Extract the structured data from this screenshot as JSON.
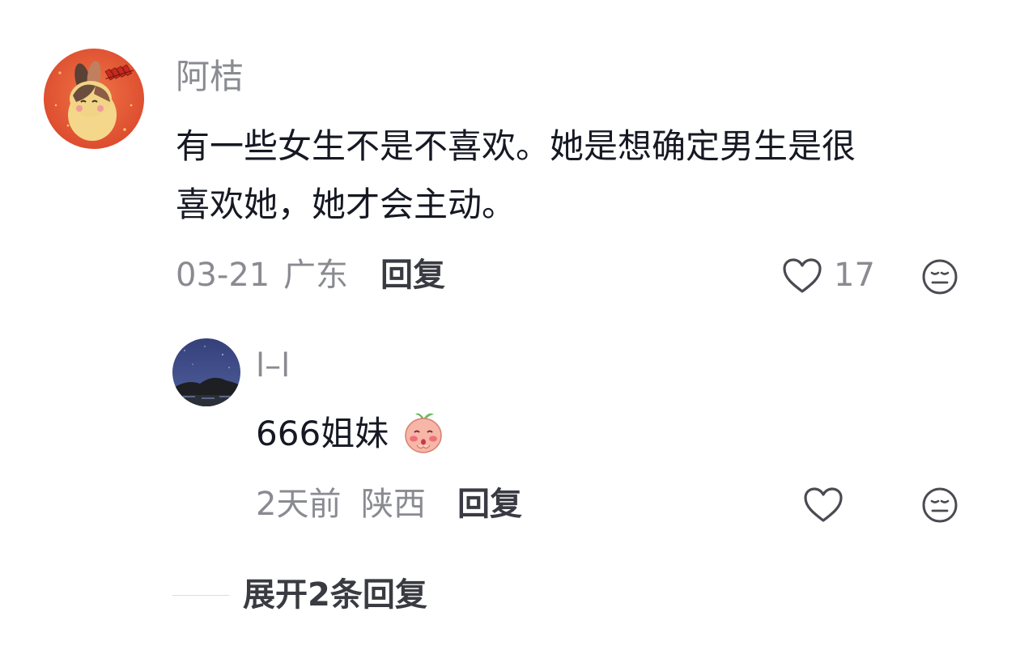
{
  "comment": {
    "username": "阿桔",
    "text": "有一些女生不是不喜欢。她是想确定男生是很\n喜欢她，她才会主动。",
    "date": "03-21",
    "location": "广东",
    "reply_label": "回复",
    "like_count": "17",
    "icons": [
      "avatar-rabbit",
      "heart-outline-icon",
      "dislike-face-icon"
    ]
  },
  "reply": {
    "username": "l–l",
    "text": "666姐妹",
    "emoji": "peach-blushing-emoji",
    "date": "2天前",
    "location": "陕西",
    "reply_label": "回复",
    "like_count": "",
    "icons": [
      "avatar-night-landscape",
      "heart-outline-icon",
      "dislike-face-icon"
    ]
  },
  "expand": {
    "label": "展开2条回复"
  },
  "colors": {
    "primary_text": "#161823",
    "secondary_text": "#8a8b91",
    "action_text": "#3a3b42",
    "avatar_bg_orange": "#e05a36",
    "avatar_bg_night": "#3c4a86"
  }
}
